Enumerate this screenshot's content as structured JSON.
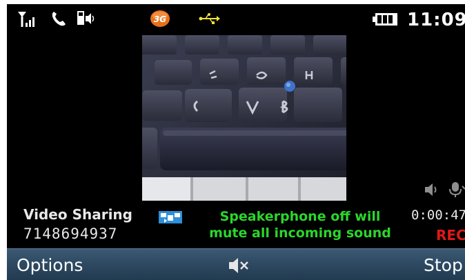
{
  "status_bar": {
    "time": "11:09",
    "network_badge": "3G",
    "icons": [
      "signal-icon",
      "call-icon",
      "speaker-icon",
      "3g-icon",
      "usb-icon",
      "battery-icon"
    ]
  },
  "call": {
    "title": "Video Sharing",
    "number": "7148694937",
    "timer": "0:00:47",
    "recording_label": "REC",
    "notice_line1": "Speakerphone off will",
    "notice_line2": "mute all incoming sound"
  },
  "softkeys": {
    "left": "Options",
    "center_icon": "mute-speaker-icon",
    "right": "Stop"
  },
  "colors": {
    "notice": "#2bd62b",
    "recording": "#e01818",
    "softkey_bar": "#2e4a62",
    "badge_3g": "#e8701a"
  }
}
